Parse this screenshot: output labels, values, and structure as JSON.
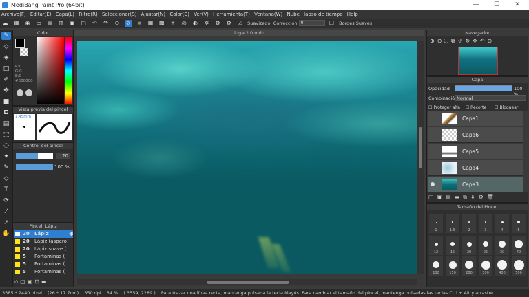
{
  "window": {
    "title": "MediBang Paint Pro (64bit)",
    "minimize": "—",
    "maximize": "☐",
    "close": "✕"
  },
  "menu": [
    "Archivo(F)",
    "Editar(E)",
    "Capa(L)",
    "Filtro(R)",
    "Seleccionar(S)",
    "Ajustar(N)",
    "Color(C)",
    "Ver(V)",
    "Herramienta(T)",
    "Ventana(W)",
    "Nube",
    "lapso de tiempo",
    "Help"
  ],
  "toolbar": {
    "smoothing_label": "Suavizado",
    "correction_label": "Corrección",
    "correction_value": "0",
    "soft_edges_label": "Bordes Suaves"
  },
  "color_panel": {
    "title": "Color",
    "r": "R:0",
    "g": "G:0",
    "b": "B:0",
    "hex": "#000000",
    "fg_color": "#000000"
  },
  "brush_preview": {
    "title": "Vista previa del pincel",
    "size": "1.45mm"
  },
  "brush_control": {
    "title": "Control del pincel",
    "size_value": "20",
    "opacity_value": "100",
    "opacity_unit": "%",
    "size_level": 0.6,
    "opacity_level": 1.0
  },
  "brush_list": {
    "title": "Pincel: Lápiz",
    "items": [
      {
        "size": "20",
        "name": "Lápiz",
        "selected": true
      },
      {
        "size": "20",
        "name": "Lápiz (áspero)",
        "selected": false
      },
      {
        "size": "20",
        "name": "Lápiz suave (",
        "selected": false
      },
      {
        "size": "5",
        "name": "Portaminas (",
        "selected": false
      },
      {
        "size": "5",
        "name": "Portaminas (",
        "selected": false
      },
      {
        "size": "5",
        "name": "Portaminas (",
        "selected": false
      }
    ]
  },
  "document": {
    "tab": "lugar2.0.mdp"
  },
  "navigator": {
    "title": "Navegador"
  },
  "layers": {
    "title": "Capa",
    "opacity_label": "Opacidad",
    "opacity_value": "100 %",
    "opacity_level": 1.0,
    "blend_label": "Combinación",
    "blend_value": "Normal",
    "protect_alpha": "Proteger alfa",
    "clip": "Recorte",
    "lock": "Bloquear",
    "items": [
      {
        "name": "Capa1"
      },
      {
        "name": "Capa6"
      },
      {
        "name": "Capa5"
      },
      {
        "name": "Capa4"
      },
      {
        "name": "Capa3"
      }
    ]
  },
  "brush_size": {
    "title": "Tamaño del Pincel",
    "row1": [
      "1",
      "1.5",
      "2",
      "3",
      "4",
      "5"
    ],
    "row2": [
      "12",
      "15",
      "20",
      "25",
      "30",
      "40"
    ],
    "row3": [
      "100",
      "150",
      "200",
      "300",
      "400",
      "500"
    ]
  },
  "status": {
    "size": "3585 * 2440 pixel",
    "physical": "(26 * 17.7cm)",
    "dpi": "350 dpi",
    "zoom": "34 %",
    "coords": "( 3559, 2289 )",
    "hint": "Para trazar una línea recta, mantenga pulsada la tecla Mayús. Para cambiar el tamaño del pincel, mantenga pulsadas las teclas Ctrl + Alt y arrastre"
  }
}
